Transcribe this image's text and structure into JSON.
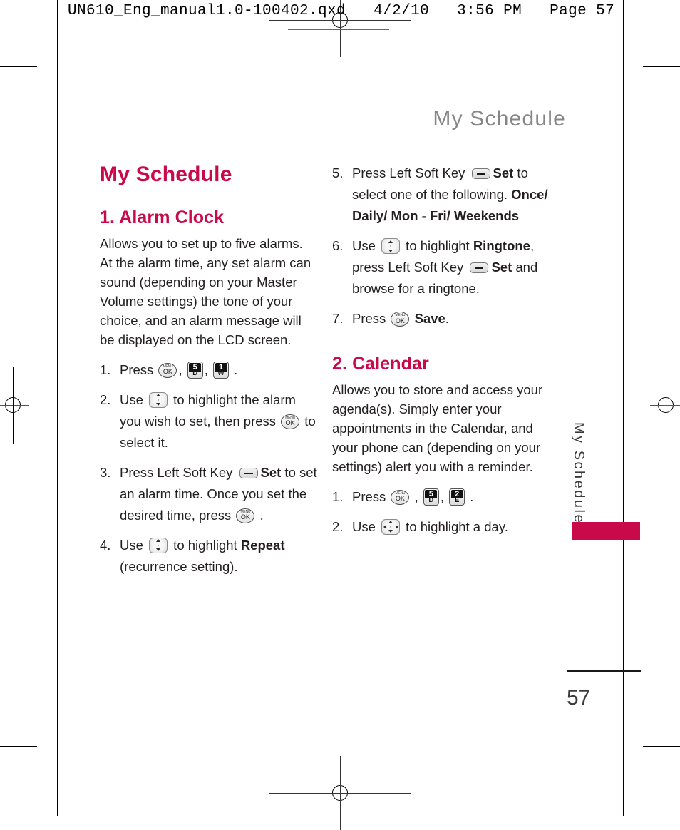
{
  "print_marks": {
    "file_header": "UN610_Eng_manual1.0-100402.qxd   4/2/10   3:56 PM   Page 57"
  },
  "running_head": "My Schedule",
  "side_tab": {
    "label": "My Schedule",
    "bar_color": "#C80A4B"
  },
  "folio": {
    "page_number": "57"
  },
  "theme": {
    "accent": "#C80A4B",
    "body_text": "#231f20",
    "running_head_color": "#868686"
  },
  "left_column": {
    "chapter_title": "My Schedule",
    "section_title": "1. Alarm Clock",
    "intro": "Allows you to set up to five alarms. At the alarm time, any set alarm can sound (depending on your Master Volume settings) the tone of your choice, and an alarm message will be displayed on the LCD screen.",
    "steps": [
      {
        "num": "1.",
        "parts": [
          {
            "t": "text",
            "v": "Press "
          },
          {
            "t": "key-ok"
          },
          {
            "t": "text",
            "v": ", "
          },
          {
            "t": "key-num",
            "digit": "5",
            "letter": "D"
          },
          {
            "t": "text",
            "v": ", "
          },
          {
            "t": "key-num",
            "digit": "1",
            "letter": "W"
          },
          {
            "t": "text",
            "v": " ."
          }
        ]
      },
      {
        "num": "2.",
        "parts": [
          {
            "t": "text",
            "v": "Use "
          },
          {
            "t": "key-nav",
            "dirs": "ud"
          },
          {
            "t": "text",
            "v": " to highlight the alarm you wish to set, then press "
          },
          {
            "t": "key-ok"
          },
          {
            "t": "text",
            "v": " to select it."
          }
        ]
      },
      {
        "num": "3.",
        "parts": [
          {
            "t": "text",
            "v": "Press Left Soft Key "
          },
          {
            "t": "key-soft"
          },
          {
            "t": "bold",
            "v": "Set"
          },
          {
            "t": "text",
            "v": " to set an alarm time. Once you set the desired time, press "
          },
          {
            "t": "key-ok"
          },
          {
            "t": "text",
            "v": " ."
          }
        ]
      },
      {
        "num": "4.",
        "parts": [
          {
            "t": "text",
            "v": "Use "
          },
          {
            "t": "key-nav",
            "dirs": "ud"
          },
          {
            "t": "text",
            "v": " to highlight "
          },
          {
            "t": "bold",
            "v": "Repeat"
          },
          {
            "t": "text",
            "v": " (recurrence setting)."
          }
        ]
      }
    ]
  },
  "right_column": {
    "steps_continued": [
      {
        "num": "5.",
        "parts": [
          {
            "t": "text",
            "v": "Press Left Soft Key "
          },
          {
            "t": "key-soft"
          },
          {
            "t": "bold",
            "v": "Set"
          },
          {
            "t": "text",
            "v": " to select one of the following. "
          },
          {
            "t": "bold",
            "v": "Once/ Daily/ Mon - Fri/ Weekends"
          }
        ]
      },
      {
        "num": "6.",
        "parts": [
          {
            "t": "text",
            "v": "Use "
          },
          {
            "t": "key-nav",
            "dirs": "ud"
          },
          {
            "t": "text",
            "v": " to highlight "
          },
          {
            "t": "bold",
            "v": "Ringtone"
          },
          {
            "t": "text",
            "v": ", press Left Soft Key "
          },
          {
            "t": "key-soft"
          },
          {
            "t": "bold",
            "v": "Set"
          },
          {
            "t": "text",
            "v": " and browse for a ringtone."
          }
        ]
      },
      {
        "num": "7.",
        "parts": [
          {
            "t": "text",
            "v": "Press "
          },
          {
            "t": "key-ok"
          },
          {
            "t": "text",
            "v": " "
          },
          {
            "t": "bold",
            "v": "Save"
          },
          {
            "t": "text",
            "v": "."
          }
        ]
      }
    ],
    "section_title": "2. Calendar",
    "intro": "Allows you to store and access your agenda(s). Simply enter your appointments in the Calendar, and your phone can (depending on your settings) alert you with a reminder.",
    "steps": [
      {
        "num": "1.",
        "parts": [
          {
            "t": "text",
            "v": "Press "
          },
          {
            "t": "key-ok"
          },
          {
            "t": "text",
            "v": " , "
          },
          {
            "t": "key-num",
            "digit": "5",
            "letter": "D"
          },
          {
            "t": "text",
            "v": ", "
          },
          {
            "t": "key-num",
            "digit": "2",
            "letter": "E"
          },
          {
            "t": "text",
            "v": " ."
          }
        ]
      },
      {
        "num": "2.",
        "parts": [
          {
            "t": "text",
            "v": "Use "
          },
          {
            "t": "key-nav",
            "dirs": "udlr"
          },
          {
            "t": "text",
            "v": " to highlight a day."
          }
        ]
      }
    ]
  }
}
